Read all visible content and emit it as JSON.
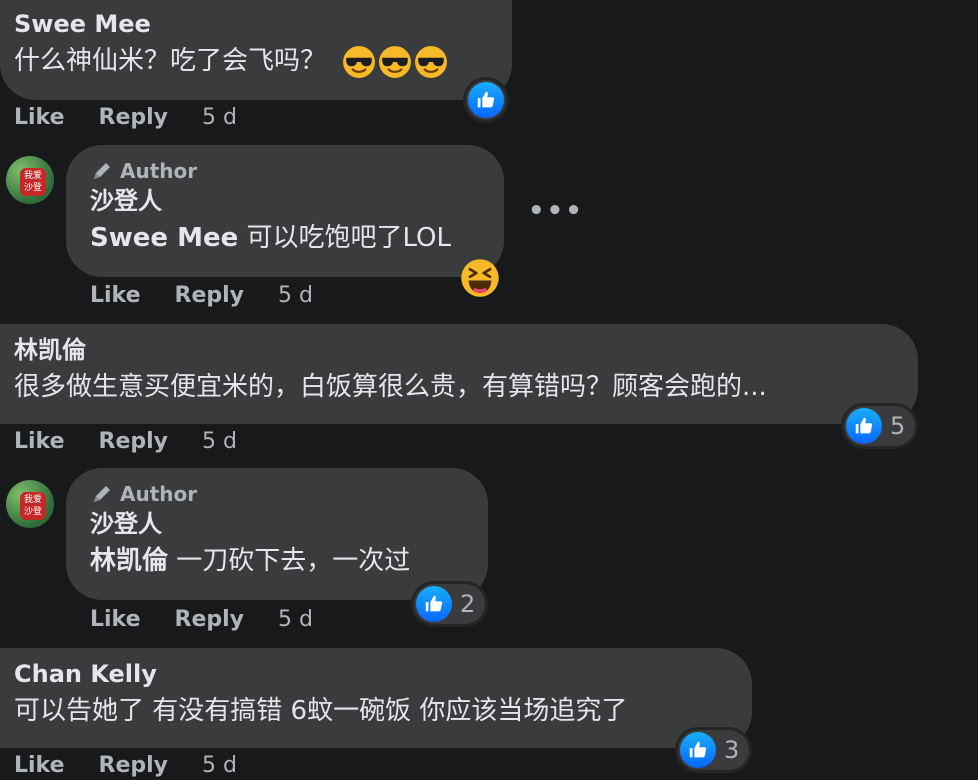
{
  "comments": [
    {
      "name": "Swee Mee",
      "text": "什么神仙米？吃了会飞吗？",
      "actions": {
        "like": "Like",
        "reply": "Reply",
        "time": "5 d"
      }
    },
    {
      "author_label": "Author",
      "name": "沙登人",
      "mention": "Swee Mee",
      "text": " 可以吃饱吧了LOL",
      "actions": {
        "like": "Like",
        "reply": "Reply",
        "time": "5 d"
      },
      "avatar_text": "我爱沙登"
    },
    {
      "name": "林凯倫",
      "text": "很多做生意买便宜米的，白饭算很么贵，有算错吗？顾客会跑的...",
      "reaction_count": "5",
      "actions": {
        "like": "Like",
        "reply": "Reply",
        "time": "5 d"
      }
    },
    {
      "author_label": "Author",
      "name": "沙登人",
      "mention": "林凯倫",
      "text": " 一刀砍下去，一次过",
      "reaction_count": "2",
      "actions": {
        "like": "Like",
        "reply": "Reply",
        "time": "5 d"
      },
      "avatar_text": "我爱沙登"
    },
    {
      "name": "Chan Kelly",
      "text": "可以告她了 有没有搞错 6蚊一碗饭 你应该当场追究了",
      "reaction_count": "3",
      "actions": {
        "like": "Like",
        "reply": "Reply",
        "time": "5 d"
      }
    }
  ],
  "more_menu": "•••",
  "icons": [
    "like-icon",
    "sunglasses-emoji-icon",
    "laughing-emoji-icon",
    "pen-icon",
    "more-options-icon"
  ],
  "colors": {
    "background": "#18191a",
    "bubble": "#3a3b3c",
    "like_blue": "#0866ff",
    "secondary_text": "#b0b3b8"
  }
}
